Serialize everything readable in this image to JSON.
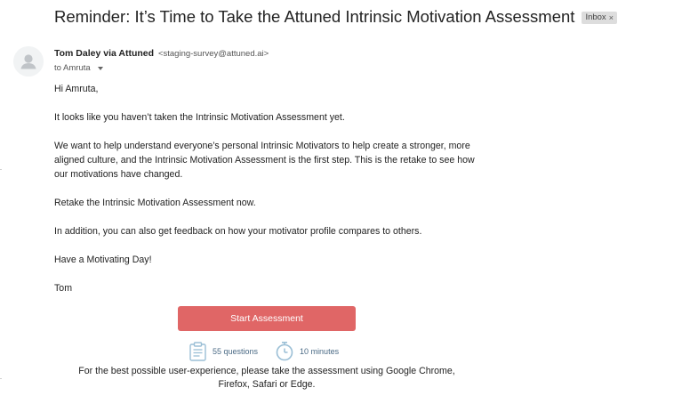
{
  "email": {
    "subject": "Reminder: It’s Time to Take the Attuned Intrinsic Motivation Assessment",
    "label_chip": "Inbox",
    "label_chip_close": "×",
    "sender_name": "Tom Daley via Attuned",
    "sender_email": "<staging-survey@attuned.ai>",
    "recipient_line": "to Amruta",
    "body": [
      "Hi Amruta,",
      "It looks like you haven’t taken the Intrinsic Motivation Assessment yet.",
      "We want to help understand everyone’s personal Intrinsic Motivators to help create a stronger, more aligned culture, and the Intrinsic Motivation Assessment is the first step. This is the retake to see how our motivations have changed.",
      "Retake the Intrinsic Motivation Assessment now.",
      "In addition, you can also get feedback on how your motivator profile compares to others.",
      "Have a Motivating Day!",
      "Tom"
    ],
    "cta_label": "Start Assessment",
    "questions_count": "55 questions",
    "duration": "10 minutes",
    "footer_note": "For the best possible user-experience, please take the assessment using Google Chrome, Firefox, Safari or Edge."
  },
  "colors": {
    "cta_background": "#e06666",
    "meta_icon": "#9bbfd6",
    "meta_text": "#4a6a85"
  },
  "icons": {
    "avatar": "person-silhouette-icon",
    "recipient_dropdown": "caret-down-icon",
    "questions": "clipboard-icon",
    "duration": "stopwatch-icon"
  }
}
